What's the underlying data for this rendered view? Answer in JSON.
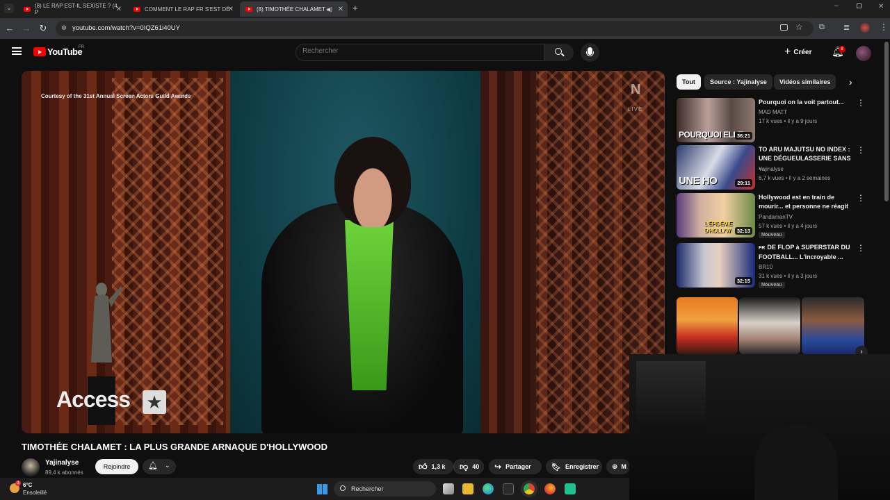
{
  "browser": {
    "tabs": [
      {
        "label": "(8) LE RAP EST-IL SEXISTE ? (4 P",
        "active": false
      },
      {
        "label": "COMMENT LE RAP FR S'EST DÉ",
        "active": false
      },
      {
        "label": "(8) TIMOTHÉE CHALAMET :",
        "active": true
      }
    ],
    "url": "youtube.com/watch?v=0IQZ61i40UY"
  },
  "youtube": {
    "logo_text": "YouTube",
    "region": "FR",
    "search_placeholder": "Rechercher",
    "create_label": "Créer",
    "notification_count": "8"
  },
  "video": {
    "courtesy_text": "Courtesy of the 31st Annual Screen Actors Guild Awards",
    "live_n": "N",
    "live_text": "LIVE",
    "watermark": "Access",
    "title": "TIMOTHÉE CHALAMET : LA PLUS GRANDE ARNAQUE D'HOLLYWOOD",
    "channel_name": "Yajinalyse",
    "channel_subs": "89,4 k abonnés",
    "join_label": "Rejoindre",
    "likes": "1,3 k",
    "dislikes": "40",
    "share_label": "Partager",
    "save_label": "Enregistrer",
    "more_label": "M"
  },
  "sidebar": {
    "chips": [
      "Tout",
      "Source : Yajinalyse",
      "Vidéos similaires"
    ],
    "recommendations": [
      {
        "title": "Pourquoi on la voit partout...",
        "channel": "MAD MATT",
        "meta": "17 k vues • il y a 9 jours",
        "duration": "36:21",
        "thumb_text": "POURQUOI ELLE",
        "badge": ""
      },
      {
        "title": "TO ARU MAJUTSU NO INDEX : UNE DÉGUEULASSERIE SANS ...",
        "channel": "Yajinalyse",
        "meta": "6,7 k vues • il y a 2 semaines",
        "duration": "29:11",
        "thumb_text": "UNE HO",
        "badge": ""
      },
      {
        "title": "Hollywood est en train de mourir... et personne ne réagit",
        "channel": "PandamanTV",
        "meta": "57 k vues • il y a 4 jours",
        "duration": "32:13",
        "thumb_text": "L'ÉPIDÉMIE D'HOLLYW",
        "badge": "Nouveau"
      },
      {
        "title": "DE FLOP à SUPERSTAR DU FOOTBALL... L'incroyable ...",
        "title_prefix": "FR",
        "channel": "BR10",
        "meta": "31 k vues • il y a 3 jours",
        "duration": "32:15",
        "thumb_text": "",
        "badge": "Nouveau"
      }
    ]
  },
  "taskbar": {
    "weather_temp": "6°C",
    "weather_desc": "Ensoleillé",
    "weather_badge": "3",
    "search_label": "Rechercher"
  }
}
